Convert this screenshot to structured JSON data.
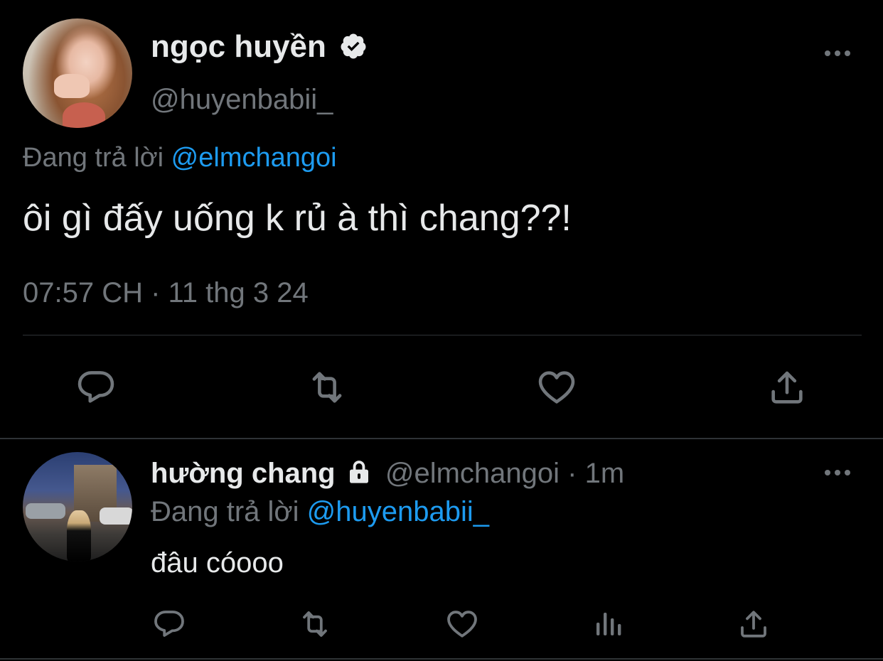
{
  "main_tweet": {
    "display_name": "ngọc huyền",
    "handle": "@huyenbabii_",
    "replying_prefix": "Đang trả lời",
    "replying_to": "@elmchangoi",
    "text": "ôi gì đấy uống k rủ à thì chang??!",
    "timestamp": "07:57 CH · 11 thg 3 24",
    "actions": [
      "reply-icon",
      "retweet-icon",
      "like-icon",
      "share-icon"
    ]
  },
  "reply_tweet": {
    "display_name": "hường chang",
    "handle": "@elmchangoi",
    "time_ago": "· 1m",
    "replying_prefix": "Đang trả lời",
    "replying_to": "@huyenbabii_",
    "text": "đâu cóooo",
    "actions": [
      "reply-icon",
      "retweet-icon",
      "like-icon",
      "views-icon",
      "share-icon"
    ]
  },
  "colors": {
    "background": "#000000",
    "text": "#e7e9ea",
    "muted": "#71767b",
    "accent": "#1d9bf0",
    "divider": "#2f3336"
  }
}
